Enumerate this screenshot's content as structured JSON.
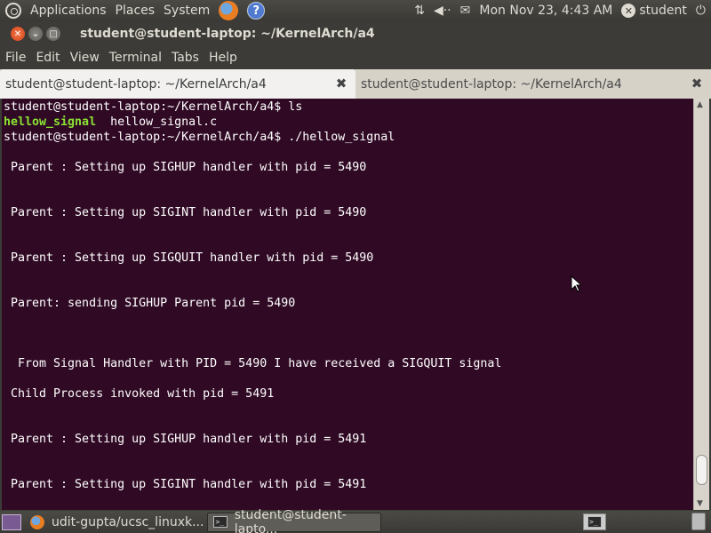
{
  "top_panel": {
    "menus": [
      "Applications",
      "Places",
      "System"
    ],
    "clock": "Mon Nov 23,  4:43 AM",
    "user": "student"
  },
  "window": {
    "title": "student@student-laptop: ~/KernelArch/a4",
    "menu": [
      "File",
      "Edit",
      "View",
      "Terminal",
      "Tabs",
      "Help"
    ],
    "tabs": [
      {
        "label": "student@student-laptop: ~/KernelArch/a4",
        "active": true
      },
      {
        "label": "student@student-laptop: ~/KernelArch/a4",
        "active": false
      }
    ]
  },
  "terminal": {
    "lines": [
      "student@student-laptop:~/KernelArch/a4$ ls",
      "",
      "student@student-laptop:~/KernelArch/a4$ ./hellow_signal",
      "",
      " Parent : Setting up SIGHUP handler with pid = 5490",
      "",
      "",
      " Parent : Setting up SIGINT handler with pid = 5490",
      "",
      "",
      " Parent : Setting up SIGQUIT handler with pid = 5490",
      "",
      "",
      " Parent: sending SIGHUP Parent pid = 5490",
      "",
      "",
      "",
      "  From Signal Handler with PID = 5490 I have received a SIGQUIT signal",
      "",
      " Child Process invoked with pid = 5491",
      "",
      "",
      " Parent : Setting up SIGHUP handler with pid = 5491",
      "",
      "",
      " Parent : Setting up SIGINT handler with pid = 5491"
    ],
    "ls_output": {
      "executable": "hellow_signal",
      "source": "  hellow_signal.c"
    },
    "colors": {
      "background": "#300a24",
      "foreground": "#ffffff",
      "executable": "#8ae234"
    }
  },
  "bottom_panel": {
    "tasks": [
      {
        "label": "udit-gupta/ucsc_linuxk...",
        "icon": "firefox-icon",
        "active": false
      },
      {
        "label": "student@student-lapto...",
        "icon": "terminal-icon",
        "active": true
      }
    ]
  }
}
